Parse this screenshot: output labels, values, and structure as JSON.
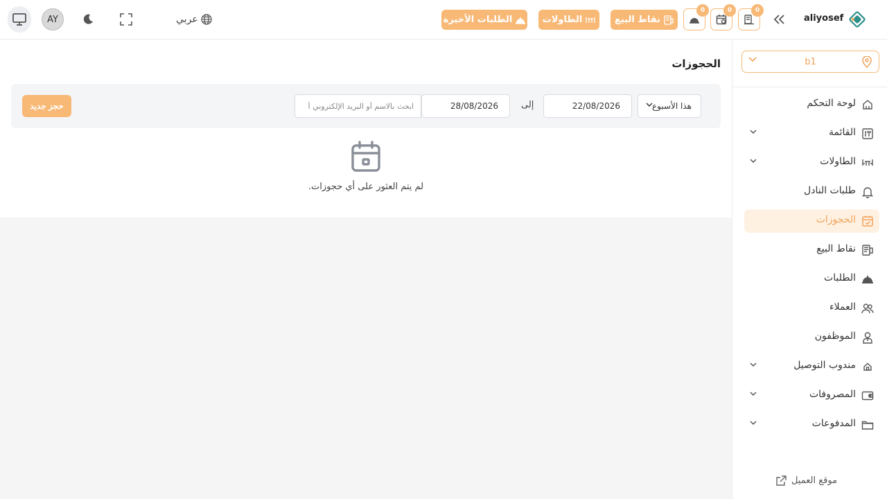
{
  "header": {
    "avatar_initials": "AY",
    "language_label": "عربي",
    "recent_orders_label": "الطلبات الأخيرة",
    "tables_label": "الطاولات",
    "pos_label": "نقاط البيع",
    "badges": [
      "0",
      "0",
      "0"
    ],
    "username": "aliyosef"
  },
  "sidebar": {
    "branch": "b1",
    "items": [
      {
        "label": "لوحة التحكم",
        "icon": "home-icon",
        "has_submenu": false
      },
      {
        "label": "القائمة",
        "icon": "menu-icon",
        "has_submenu": true
      },
      {
        "label": "الطاولات",
        "icon": "tables-icon",
        "has_submenu": true
      },
      {
        "label": "طلبات النادل",
        "icon": "bell-icon",
        "has_submenu": false
      },
      {
        "label": "الحجوزات",
        "icon": "calendar-check-icon",
        "has_submenu": false,
        "active": true
      },
      {
        "label": "نقاط البيع",
        "icon": "pos-icon",
        "has_submenu": false
      },
      {
        "label": "الطلبات",
        "icon": "cloche-icon",
        "has_submenu": false
      },
      {
        "label": "العملاء",
        "icon": "users-icon",
        "has_submenu": false
      },
      {
        "label": "الموظفون",
        "icon": "staff-icon",
        "has_submenu": false
      },
      {
        "label": "مندوب التوصيل",
        "icon": "delivery-icon",
        "has_submenu": true
      },
      {
        "label": "المصروفات",
        "icon": "wallet-icon",
        "has_submenu": true
      },
      {
        "label": "المدفوعات",
        "icon": "folder-icon",
        "has_submenu": true
      }
    ],
    "customer_site_label": "موقع العميل"
  },
  "main": {
    "title": "الحجوزات",
    "filters": {
      "range_selected": "هذا الأسبوع",
      "from_date": "22/08/2026",
      "to_label": "إلى",
      "to_date": "28/08/2026",
      "search_placeholder": "ابحث بالاسم أو البريد الإلكتروني أ"
    },
    "new_booking_label": "حجز جديد",
    "empty_message": "لم يتم العثور على أي حجوزات."
  },
  "colors": {
    "accent": "#f8b977",
    "accent_text": "#f0a35a",
    "active_bg": "#fff1e2"
  }
}
